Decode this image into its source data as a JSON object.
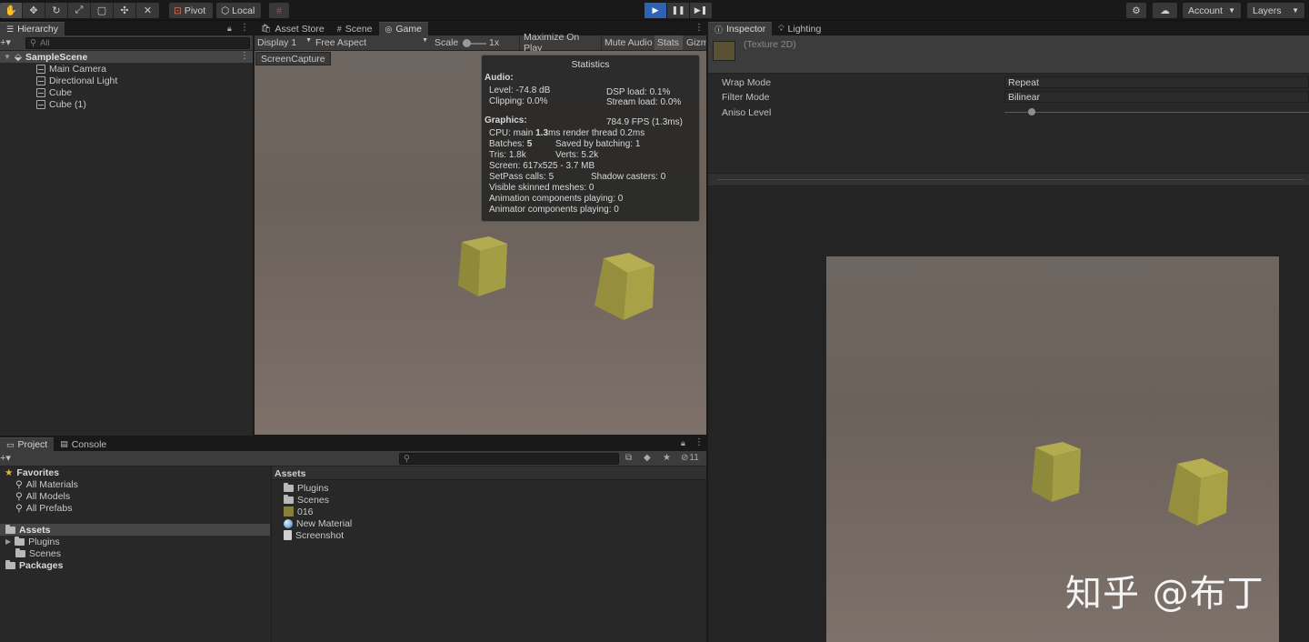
{
  "toolbar": {
    "tools": [
      "hand-icon",
      "move-icon",
      "rotate-icon",
      "scale-icon",
      "rect-icon",
      "transform-icon",
      "custom-tool-icon"
    ],
    "pivot_label": "Pivot",
    "local_label": "Local",
    "account_label": "Account",
    "layers_label": "Layers"
  },
  "hierarchy": {
    "tab": "Hierarchy",
    "search_placeholder": "All",
    "scene": "SampleScene",
    "items": [
      "Main Camera",
      "Directional Light",
      "Cube",
      "Cube (1)"
    ]
  },
  "center_tabs": [
    "Asset Store",
    "Scene",
    "Game"
  ],
  "game_toolbar": {
    "display": "Display 1",
    "aspect": "Free Aspect",
    "scale_label": "Scale",
    "scale_value": "1x",
    "maximize": "Maximize On Play",
    "mute": "Mute Audio",
    "stats": "Stats",
    "gizmos": "Gizm"
  },
  "screen_capture_button": "ScreenCapture",
  "stats": {
    "title": "Statistics",
    "audio_header": "Audio:",
    "level": "Level: -74.8 dB",
    "dsp": "DSP load: 0.1%",
    "clipping": "Clipping: 0.0%",
    "stream": "Stream load: 0.0%",
    "graphics_header": "Graphics:",
    "fps": "784.9 FPS (1.3ms)",
    "cpu_a": "CPU: main ",
    "cpu_b": "1.3",
    "cpu_c": "ms  render thread 0.2ms",
    "batches_a": "Batches: ",
    "batches_b": "5",
    "saved": "Saved by batching: 1",
    "tris": "Tris: 1.8k",
    "verts": "Verts: 5.2k",
    "screen": "Screen: 617x525 - 3.7 MB",
    "setpass": "SetPass calls: 5",
    "shadow": "Shadow casters: 0",
    "skinned": "Visible skinned meshes: 0",
    "animation": "Animation components playing: 0",
    "animator": "Animator components playing: 0"
  },
  "inspector": {
    "tabs": [
      "Inspector",
      "Lighting"
    ],
    "texture_label": "(Texture 2D)",
    "props": [
      {
        "label": "Wrap Mode",
        "value": "Repeat"
      },
      {
        "label": "Filter Mode",
        "value": "Bilinear"
      },
      {
        "label": "Aniso Level",
        "value": ""
      }
    ],
    "aniso_level": 0.01
  },
  "project": {
    "tabs": [
      "Project",
      "Console"
    ],
    "hidden_count": "11",
    "favorites_label": "Favorites",
    "favorites": [
      "All Materials",
      "All Models",
      "All Prefabs"
    ],
    "assets_label": "Assets",
    "asset_tree": [
      "Plugins",
      "Scenes"
    ],
    "packages_label": "Packages",
    "breadcrumb": "Assets",
    "files": [
      {
        "name": "Plugins",
        "icon": "folder-icon"
      },
      {
        "name": "Scenes",
        "icon": "folder-icon"
      },
      {
        "name": "016",
        "icon": "texture-icon"
      },
      {
        "name": "New Material",
        "icon": "material-icon"
      },
      {
        "name": "Screenshot",
        "icon": "script-icon"
      }
    ]
  },
  "watermark": "知乎 @布丁"
}
